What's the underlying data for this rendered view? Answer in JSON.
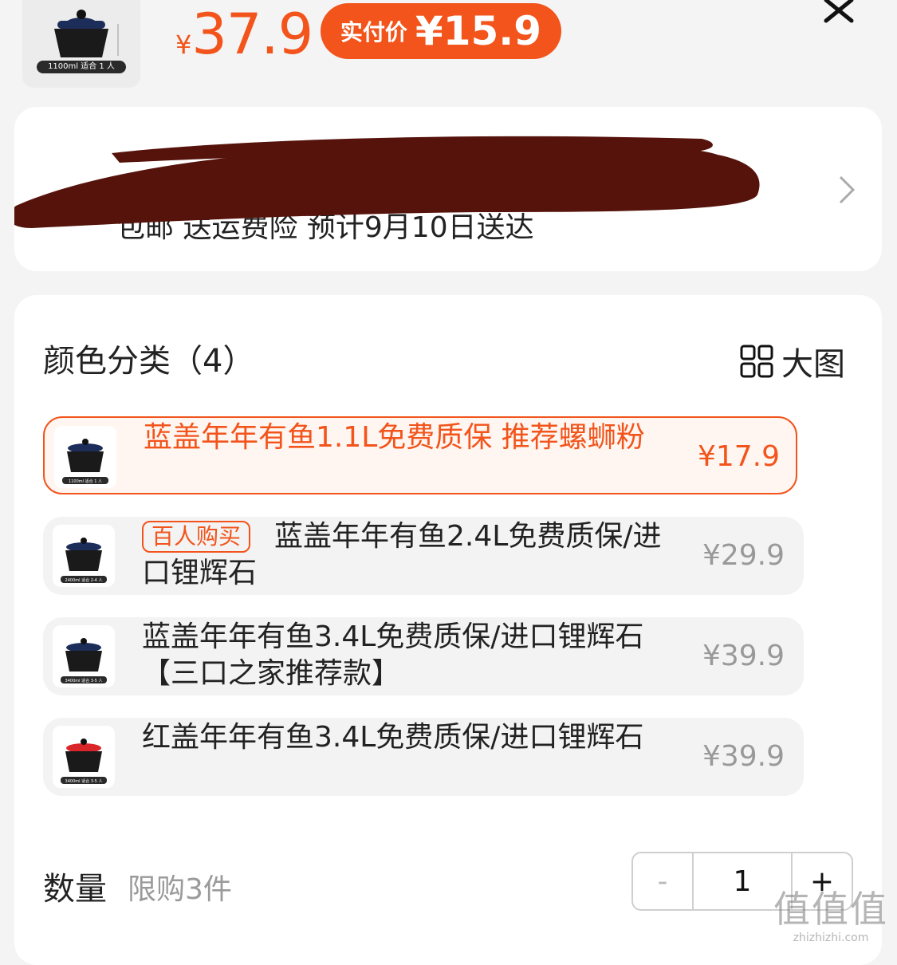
{
  "header": {
    "thumb_caption": "1100ml 适合 1 人",
    "currency": "¥",
    "price": "37.9",
    "real_pay_label": "实付价",
    "real_pay_value": "¥15.9"
  },
  "address": {
    "line2": "包邮 送运费险 预计9月10日送达"
  },
  "sku": {
    "title": "颜色分类（4）",
    "big_view": "大图",
    "options": [
      {
        "name": "蓝盖年年有鱼1.1L免费质保 推荐螺蛳粉",
        "price": "¥17.9",
        "caption": "1100ml 适合 1 人",
        "lid": "#1c2d5a",
        "selected": true
      },
      {
        "tag": "百人购买",
        "name": "蓝盖年年有鱼2.4L免费质保/进口锂辉石",
        "price": "¥29.9",
        "caption": "2400ml 适合 2-4 人",
        "lid": "#1c2d5a"
      },
      {
        "name": "蓝盖年年有鱼3.4L免费质保/进口锂辉石 【三口之家推荐款】",
        "price": "¥39.9",
        "caption": "3400ml 适合 3-5 人",
        "lid": "#1c2d5a"
      },
      {
        "name": "红盖年年有鱼3.4L免费质保/进口锂辉石",
        "price": "¥39.9",
        "caption": "3400ml 适合 3-5 人",
        "lid": "#d9262a"
      }
    ]
  },
  "quantity": {
    "label": "数量",
    "limit": "限购3件",
    "minus": "-",
    "value": "1",
    "plus": "+"
  },
  "watermark": {
    "big": "值值值",
    "small": "zhizhizhi.com"
  },
  "colors": {
    "accent": "#f2541b",
    "scribble": "#56130b"
  }
}
